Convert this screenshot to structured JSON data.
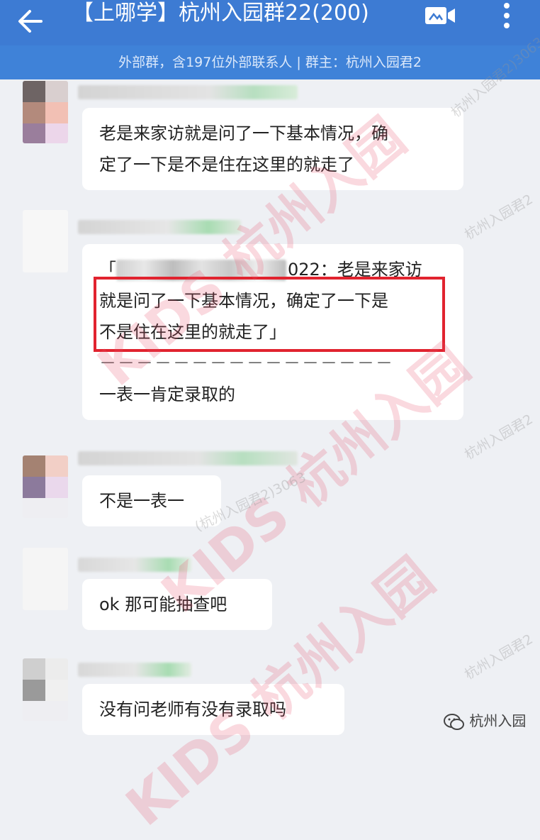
{
  "header": {
    "title": "【上哪学】杭州入园群22(200)",
    "subtitle": "外部群，含197位外部联系人 | 群主：杭州入园君2",
    "back_icon": "back-arrow-icon",
    "video_icon": "video-call-icon",
    "more_icon": "more-vertical-icon"
  },
  "messages": [
    {
      "lines": [
        "老是来家访就是问了一下基本情况，确",
        "定了一下是不是住在这里的就走了"
      ]
    },
    {
      "quote_prefix": "「",
      "quote_suffix": "022：老是来家访",
      "lines": [
        "就是问了一下基本情况，确定了一下是",
        "不是住在这里的就走了」",
        "－－－－－－－－－－－－－－－－",
        "一表一肯定录取的"
      ]
    },
    {
      "lines": [
        "不是一表一"
      ]
    },
    {
      "lines": [
        "ok 那可能抽查吧"
      ]
    },
    {
      "lines": [
        "没有问老师有没有录取吗"
      ]
    }
  ],
  "watermarks": {
    "main": "KIDS 杭州入园",
    "small_1": "杭州入园君2)3063",
    "small_2": "杭州入园君2",
    "small_3": "(杭州入园君2)3063"
  },
  "brand": {
    "label": "杭州入园",
    "icon": "wechat-icon"
  },
  "colors": {
    "header_bg": "#3d7bd3",
    "subheader_bg": "#3f82d8",
    "chat_bg": "#eef0f4",
    "highlight": "#e1232f"
  }
}
